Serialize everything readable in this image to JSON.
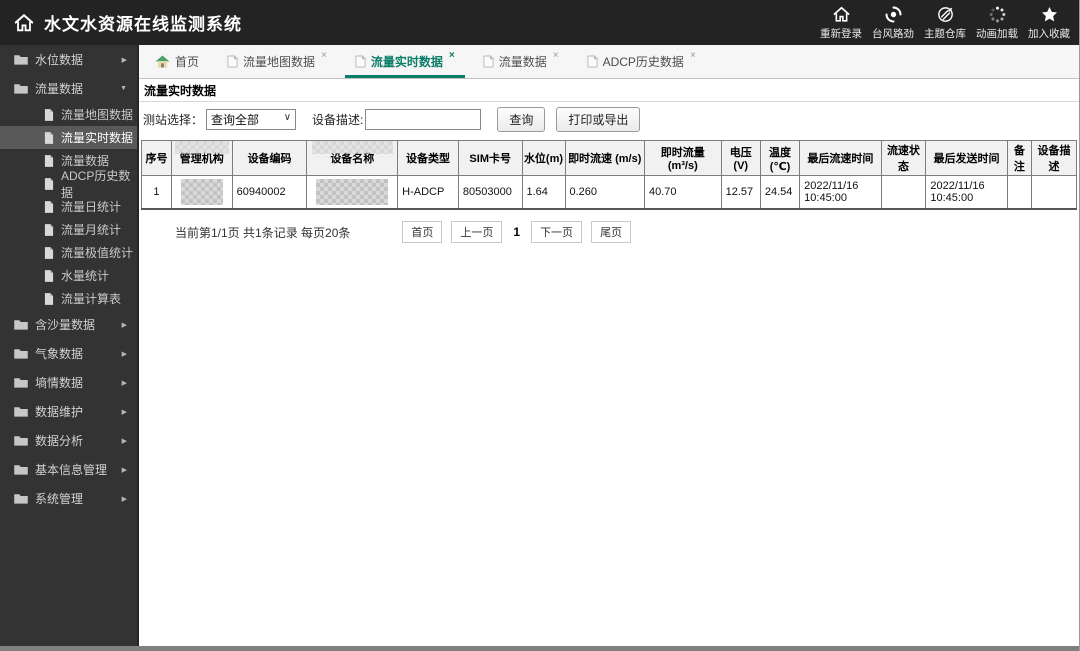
{
  "header": {
    "title": "水文水资源在线监测系统",
    "actions": [
      {
        "label": "重新登录",
        "icon": "home-icon"
      },
      {
        "label": "台风路劲",
        "icon": "typhoon-icon"
      },
      {
        "label": "主题仓库",
        "icon": "theme-icon"
      },
      {
        "label": "动画加载",
        "icon": "loading-icon"
      },
      {
        "label": "加入收藏",
        "icon": "star-icon"
      }
    ]
  },
  "sidebar": {
    "items": [
      {
        "label": "水位数据",
        "expanded": false
      },
      {
        "label": "流量数据",
        "expanded": true,
        "children": [
          {
            "label": "流量地图数据"
          },
          {
            "label": "流量实时数据",
            "selected": true
          },
          {
            "label": "流量数据"
          },
          {
            "label": "ADCP历史数据"
          },
          {
            "label": "流量日统计"
          },
          {
            "label": "流量月统计"
          },
          {
            "label": "流量极值统计"
          },
          {
            "label": "水量统计"
          },
          {
            "label": "流量计算表"
          }
        ]
      },
      {
        "label": "含沙量数据",
        "expanded": false
      },
      {
        "label": "气象数据",
        "expanded": false
      },
      {
        "label": "墒情数据",
        "expanded": false
      },
      {
        "label": "数据维护",
        "expanded": false
      },
      {
        "label": "数据分析",
        "expanded": false
      },
      {
        "label": "基本信息管理",
        "expanded": false
      },
      {
        "label": "系统管理",
        "expanded": false
      }
    ]
  },
  "tabs": [
    {
      "label": "首页",
      "icon": "home-colored-icon",
      "closable": false,
      "active": false
    },
    {
      "label": "流量地图数据",
      "icon": "page-icon",
      "closable": true,
      "active": false
    },
    {
      "label": "流量实时数据",
      "icon": "page-icon",
      "closable": true,
      "active": true
    },
    {
      "label": "流量数据",
      "icon": "page-icon",
      "closable": true,
      "active": false
    },
    {
      "label": "ADCP历史数据",
      "icon": "page-icon",
      "closable": true,
      "active": false
    }
  ],
  "panel": {
    "title": "流量实时数据",
    "query": {
      "station_label": "测站选择：",
      "station_value": "查询全部",
      "device_label": "设备描述:",
      "device_value": "",
      "search_button": "查询",
      "export_button": "打印或导出"
    },
    "table": {
      "columns": [
        "序号",
        "管理机构",
        "设备编码",
        "设备名称",
        "设备类型",
        "SIM卡号",
        "水位(m)",
        "即时流速 (m/s)",
        "即时流量(m³/s)",
        "电压(V)",
        "温度(℃)",
        "最后流速时间",
        "流速状态",
        "最后发送时间",
        "备注",
        "设备描述"
      ],
      "redacted_columns": [
        1,
        3
      ],
      "rows": [
        [
          "1",
          {
            "redacted": true
          },
          "60940002",
          {
            "redacted": true
          },
          "H-ADCP",
          "80503000",
          "1.64",
          "0.260",
          "40.70",
          "12.57",
          "24.54",
          "2022/11/16\n10:45:00",
          "",
          "2022/11/16\n10:45:00",
          "",
          ""
        ]
      ]
    },
    "pagination": {
      "summary": "当前第1/1页 共1条记录 每页20条",
      "buttons": [
        {
          "label": "首页",
          "type": "btn"
        },
        {
          "label": "上一页",
          "type": "btn"
        },
        {
          "label": "1",
          "type": "current"
        },
        {
          "label": "下一页",
          "type": "btn"
        },
        {
          "label": "尾页",
          "type": "btn"
        }
      ]
    }
  },
  "colors": {
    "topbar_bg": "#232323",
    "sidebar_bg": "#333333",
    "sidebar_selected_bg": "#595959",
    "accent_green": "#0b7d68",
    "table_border": "#7d7d7d",
    "footer_strip": "#808080"
  }
}
